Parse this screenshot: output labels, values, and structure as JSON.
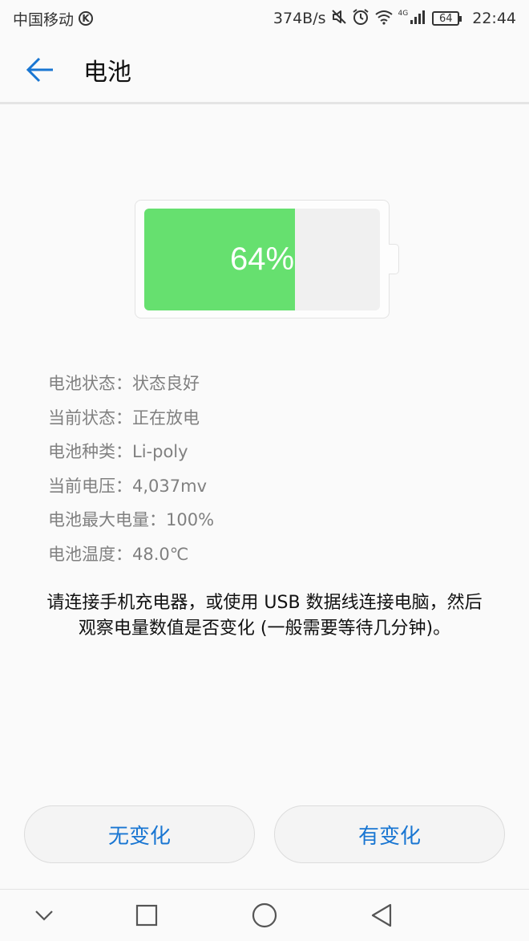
{
  "status_bar": {
    "carrier": "中国移动",
    "carrier_badge": "K",
    "net_speed": "374B/s",
    "network_type": "4G",
    "battery_level": "64",
    "time": "22:44",
    "icons": [
      "mute-icon",
      "alarm-icon",
      "wifi-icon",
      "signal-icon"
    ]
  },
  "header": {
    "title": "电池",
    "back_icon": "arrow-left-icon"
  },
  "battery": {
    "percent_label": "64%",
    "level": 0.64,
    "fill_color": "#66e06f"
  },
  "info": {
    "rows": [
      "电池状态：状态良好",
      "当前状态：正在放电",
      "电池种类：Li-poly",
      "当前电压：4,037mv",
      "电池最大电量：100%",
      "电池温度：48.0℃"
    ]
  },
  "instruction": {
    "text": "请连接手机充电器，或使用 USB 数据线连接电脑，然后观察电量数值是否变化 (一般需要等待几分钟)。"
  },
  "buttons": {
    "no_change": "无变化",
    "changed": "有变化",
    "accent_color": "#1976d2"
  },
  "nav": {
    "icons": [
      "chevron-down-icon",
      "square-icon",
      "circle-icon",
      "triangle-back-icon"
    ]
  }
}
